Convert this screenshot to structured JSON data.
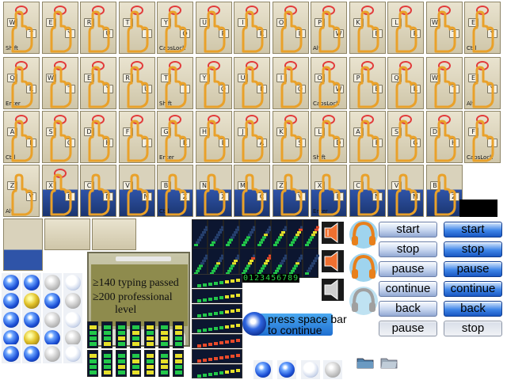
{
  "atlas": {
    "key_letters_row1": [
      "W",
      "E",
      "R",
      "T",
      "Y",
      "U",
      "I",
      "O",
      "P",
      "K",
      "L"
    ],
    "key_letters_row2": [
      "Q",
      "W",
      "E",
      "R",
      "T",
      "Y",
      "U",
      "I",
      "O",
      "P"
    ],
    "key_letters_row3": [
      "A",
      "S",
      "D",
      "F",
      "G",
      "H",
      "J",
      "K",
      "L"
    ],
    "key_letters_row4": [
      "Z",
      "X",
      "C",
      "V",
      "B",
      "N",
      "M"
    ],
    "modifier_labels": [
      "Shift",
      "Enter",
      "Ctrl",
      "Alt",
      "CapsLock"
    ]
  },
  "level_panel": {
    "line1": "≥140 typing passed",
    "line2": "≥200 professional",
    "line3": "level"
  },
  "digits_readout": "0123456789",
  "space_prompt": {
    "line1": "press space bar",
    "line2": "to continue"
  },
  "buttons": {
    "start": "start",
    "stop": "stop",
    "pause": "pause",
    "continue": "continue",
    "back": "back"
  },
  "colors": {
    "button_blue": "#3f86e8",
    "gauge_green": "#22c84a",
    "gauge_yellow": "#e6e02a",
    "gauge_red": "#e84a2a",
    "panel_olive": "#8e8b4d"
  }
}
